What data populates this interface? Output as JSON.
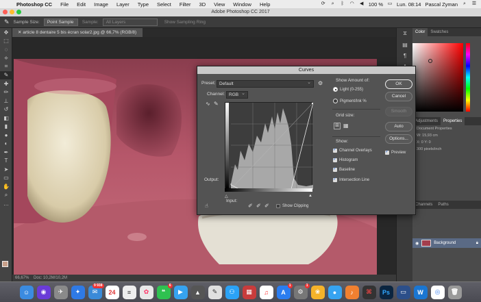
{
  "menubar": {
    "app": "Photoshop CC",
    "menus": [
      "File",
      "Edit",
      "Image",
      "Layer",
      "Type",
      "Select",
      "Filter",
      "3D",
      "View",
      "Window",
      "Help"
    ],
    "battery": "100 %",
    "clock": "Lun. 08:14",
    "user": "Pascal Zyman"
  },
  "window": {
    "title": "Adobe Photoshop CC 2017"
  },
  "options": {
    "sample_size_label": "Sample Size:",
    "sample_size_value": "Point Sample",
    "sample_label": "Sample:",
    "sample_value": "All Layers",
    "sampling_ring": "Show Sampling Ring"
  },
  "document": {
    "tab": "article 8 dentaire 5 bis écran solar2.jpg @ 66,7% (RGB/8)",
    "zoom": "66,67%",
    "status": "Doc: 10,2M/10,2M"
  },
  "panels": {
    "color_tabs": [
      "Color",
      "Swatches"
    ],
    "props_tabs": [
      "Adjustments",
      "Properties"
    ],
    "props_title": "Document Properties",
    "props_w": "15,93 cm",
    "props_x": "0",
    "props_y": "0",
    "props_res": "300 pixels/inch",
    "layers_tabs": [
      "Channels",
      "Paths"
    ],
    "layer_name": "Background"
  },
  "curves": {
    "title": "Curves",
    "preset_label": "Preset:",
    "preset_value": "Default",
    "channel_label": "Channel:",
    "channel_value": "RGB",
    "output_label": "Output:",
    "input_label": "Input:",
    "show_clipping": "Show Clipping",
    "show_amount_label": "Show Amount of:",
    "light": "Light  (0-255)",
    "pigment": "Pigment/Ink %",
    "grid_size": "Grid size:",
    "show": "Show:",
    "overlays": "Channel Overlays",
    "histogram": "Histogram",
    "baseline": "Baseline",
    "intersection": "Intersection Line",
    "ok": "OK",
    "cancel": "Cancel",
    "smooth": "Smooth",
    "auto": "Auto",
    "options": "Options...",
    "preview": "Preview"
  },
  "dock": {
    "badges": {
      "calendar": "24",
      "messages": "6",
      "appstore": "1",
      "prefs": "1",
      "mail": "9 938"
    }
  },
  "colors": {
    "dialog_bg": "#535353",
    "accent_blue": "#1a62d8",
    "fg_swatch": "#c8a08a"
  }
}
